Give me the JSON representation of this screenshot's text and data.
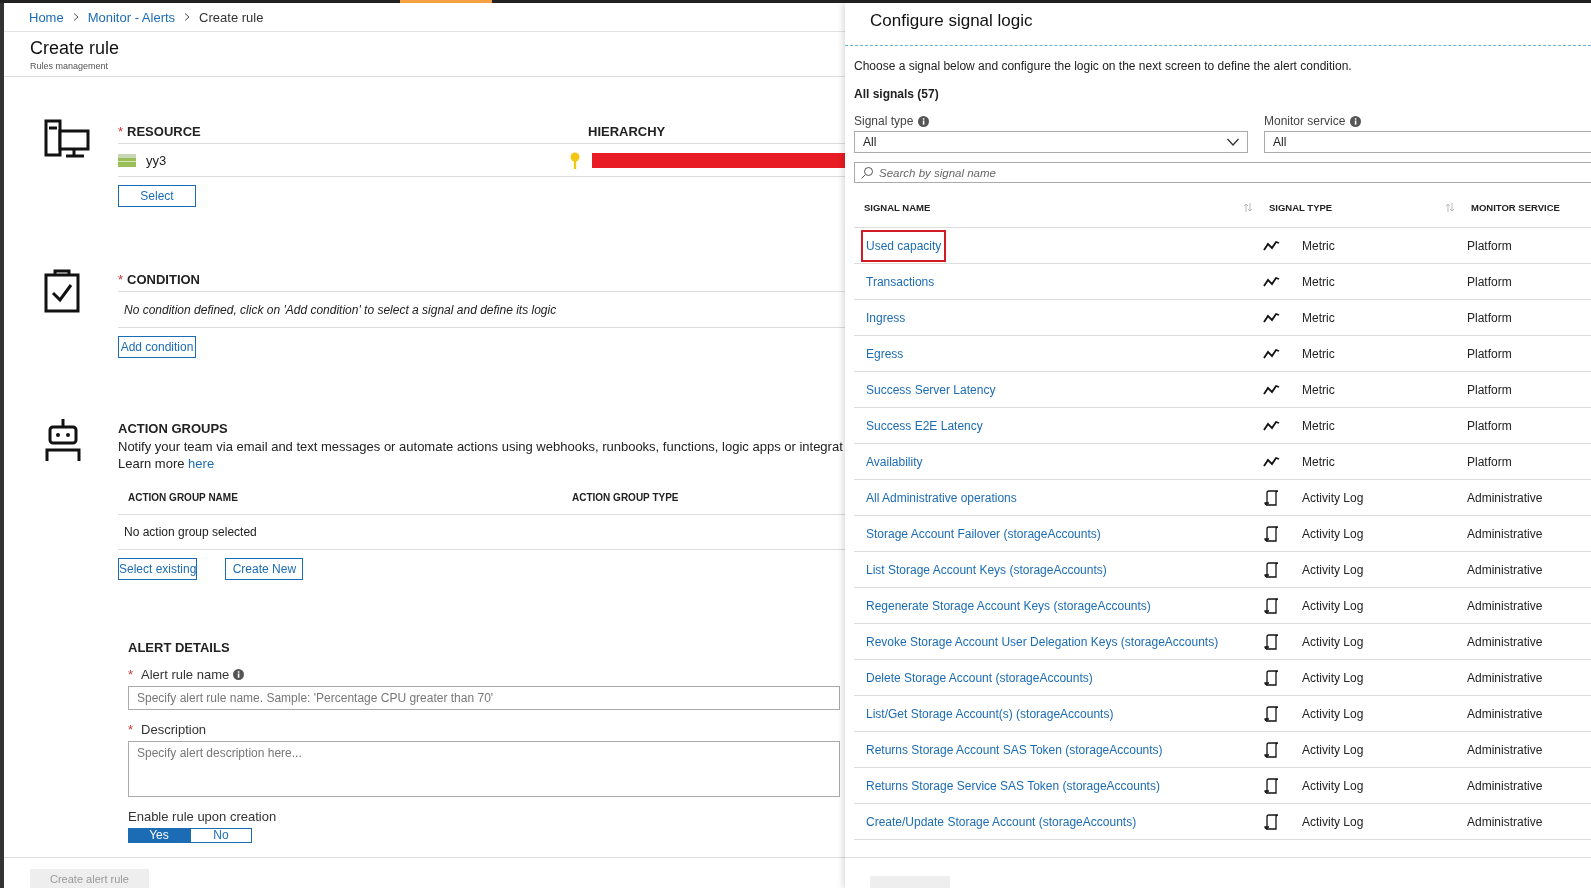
{
  "breadcrumb": [
    {
      "label": "Home",
      "link": true
    },
    {
      "label": "Monitor - Alerts",
      "link": true
    },
    {
      "label": "Create rule",
      "link": false
    }
  ],
  "page": {
    "title": "Create rule",
    "subtitle": "Rules management"
  },
  "resource": {
    "heading": "RESOURCE",
    "required_mark": "*",
    "hierarchy_heading": "HIERARCHY",
    "name": "yy3",
    "button": "Select"
  },
  "condition": {
    "heading": "CONDITION",
    "required_mark": "*",
    "empty_text": "No condition defined, click on 'Add condition' to select a signal and define its logic",
    "button": "Add condition"
  },
  "action_groups": {
    "heading": "ACTION GROUPS",
    "description": "Notify your team via email and text messages or automate actions using webhooks, runbooks, functions, logic apps or integrat",
    "learn_more": "Learn more",
    "link": "here",
    "columns": [
      "ACTION GROUP NAME",
      "ACTION GROUP TYPE"
    ],
    "empty_text": "No action group selected",
    "buttons": [
      "Select existing",
      "Create New"
    ]
  },
  "alert_details": {
    "heading": "ALERT DETAILS",
    "fields": [
      {
        "kind": "input",
        "label": "Alert rule name",
        "required_mark": "*",
        "info": true,
        "placeholder": "Specify alert rule name. Sample: 'Percentage CPU greater than 70'"
      },
      {
        "kind": "textarea",
        "label": "Description",
        "required_mark": "*",
        "info": false,
        "placeholder": "Specify alert description here..."
      }
    ],
    "enable": {
      "label": "Enable rule upon creation",
      "options": [
        {
          "label": "Yes",
          "selected": true
        },
        {
          "label": "No",
          "selected": false
        }
      ]
    }
  },
  "footer": {
    "button": "Create alert rule",
    "disabled": true
  },
  "panel": {
    "title": "Configure signal logic",
    "intro": "Choose a signal below and configure the logic on the next screen to define the alert condition.",
    "count": "All signals (57)",
    "filters": [
      {
        "label": "Signal type",
        "value": "All",
        "info": true,
        "dropdown": true
      },
      {
        "label": "Monitor service",
        "value": "All",
        "info": true,
        "dropdown": false
      }
    ],
    "search": {
      "placeholder": "Search by signal name"
    },
    "columns": [
      {
        "label": "SIGNAL NAME",
        "sortable": true
      },
      {
        "label": "SIGNAL TYPE",
        "sortable": true
      },
      {
        "label": "MONITOR SERVICE",
        "sortable": false
      }
    ],
    "rows": [
      {
        "name": "Used capacity",
        "kind": "metric",
        "type": "Metric",
        "service": "Platform",
        "highlighted": true
      },
      {
        "name": "Transactions",
        "kind": "metric",
        "type": "Metric",
        "service": "Platform",
        "highlighted": false
      },
      {
        "name": "Ingress",
        "kind": "metric",
        "type": "Metric",
        "service": "Platform",
        "highlighted": false
      },
      {
        "name": "Egress",
        "kind": "metric",
        "type": "Metric",
        "service": "Platform",
        "highlighted": false
      },
      {
        "name": "Success Server Latency",
        "kind": "metric",
        "type": "Metric",
        "service": "Platform",
        "highlighted": false
      },
      {
        "name": "Success E2E Latency",
        "kind": "metric",
        "type": "Metric",
        "service": "Platform",
        "highlighted": false
      },
      {
        "name": "Availability",
        "kind": "metric",
        "type": "Metric",
        "service": "Platform",
        "highlighted": false
      },
      {
        "name": "All Administrative operations",
        "kind": "log",
        "type": "Activity Log",
        "service": "Administrative",
        "highlighted": false
      },
      {
        "name": "Storage Account Failover (storageAccounts)",
        "kind": "log",
        "type": "Activity Log",
        "service": "Administrative",
        "highlighted": false
      },
      {
        "name": "List Storage Account Keys (storageAccounts)",
        "kind": "log",
        "type": "Activity Log",
        "service": "Administrative",
        "highlighted": false
      },
      {
        "name": "Regenerate Storage Account Keys (storageAccounts)",
        "kind": "log",
        "type": "Activity Log",
        "service": "Administrative",
        "highlighted": false
      },
      {
        "name": "Revoke Storage Account User Delegation Keys (storageAccounts)",
        "kind": "log",
        "type": "Activity Log",
        "service": "Administrative",
        "highlighted": false
      },
      {
        "name": "Delete Storage Account (storageAccounts)",
        "kind": "log",
        "type": "Activity Log",
        "service": "Administrative",
        "highlighted": false
      },
      {
        "name": "List/Get Storage Account(s) (storageAccounts)",
        "kind": "log",
        "type": "Activity Log",
        "service": "Administrative",
        "highlighted": false
      },
      {
        "name": "Returns Storage Account SAS Token (storageAccounts)",
        "kind": "log",
        "type": "Activity Log",
        "service": "Administrative",
        "highlighted": false
      },
      {
        "name": "Returns Storage Service SAS Token (storageAccounts)",
        "kind": "log",
        "type": "Activity Log",
        "service": "Administrative",
        "highlighted": false
      },
      {
        "name": "Create/Update Storage Account (storageAccounts)",
        "kind": "log",
        "type": "Activity Log",
        "service": "Administrative",
        "highlighted": false
      }
    ]
  }
}
